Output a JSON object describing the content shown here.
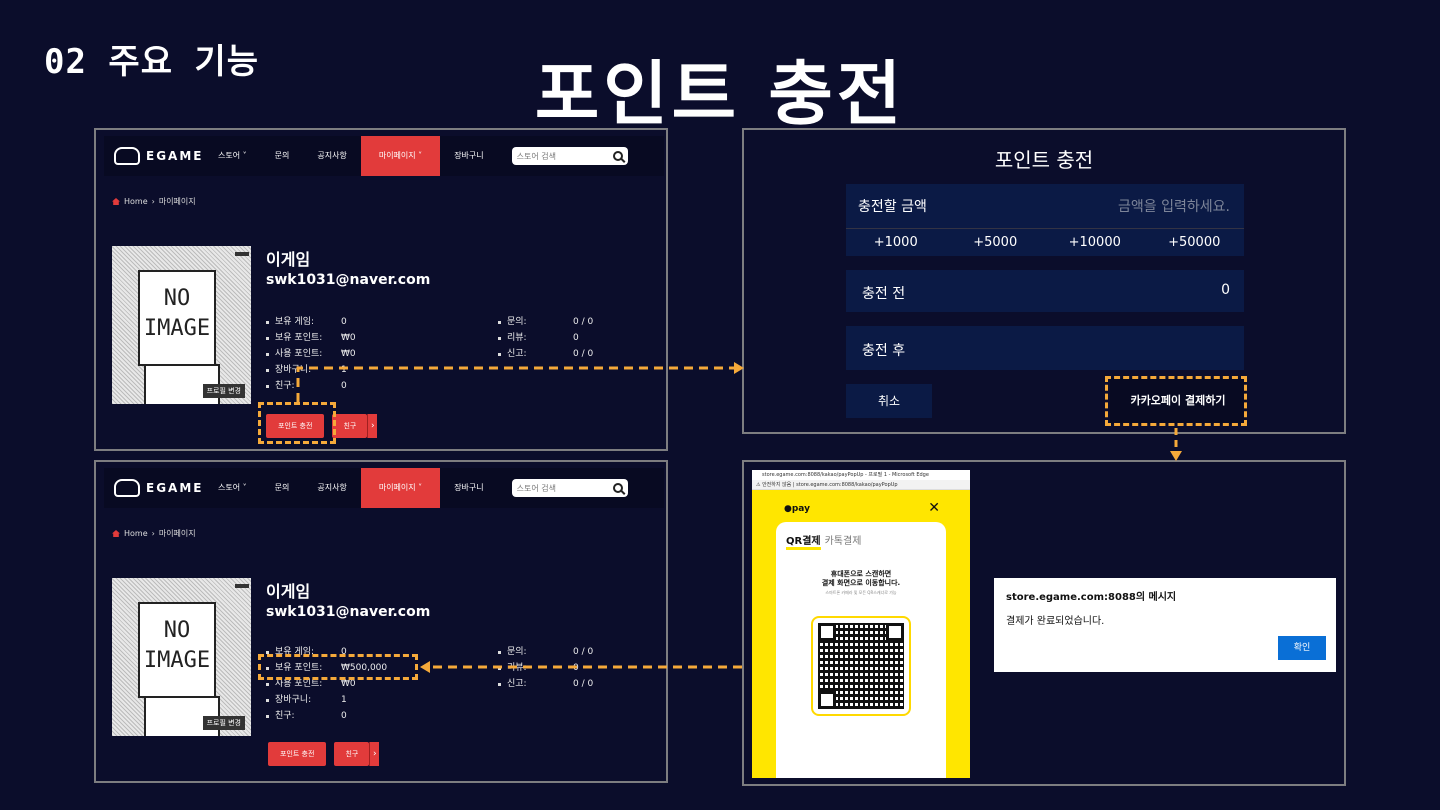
{
  "section_label": "02 주요 기능",
  "title": "포인트 충전",
  "site": {
    "logo": "EGAME",
    "nav": [
      "스토어",
      "문의",
      "공지사항",
      "마이페이지",
      "장바구니"
    ],
    "search_placeholder": "스토어 검색",
    "breadcrumb_home": "Home",
    "breadcrumb_current": "마이페이지",
    "profile_edit": "프로필 변경",
    "no_image": "NO IMAGE",
    "user_name": "이게임",
    "user_email": "swk1031@naver.com",
    "buttons": {
      "charge": "포인트 충전",
      "friends": "친구"
    }
  },
  "before": {
    "left_stats": [
      [
        "보유 게임:",
        "0"
      ],
      [
        "보유 포인트:",
        "₩0"
      ],
      [
        "사용 포인트:",
        "₩0"
      ],
      [
        "장바구니:",
        "1"
      ],
      [
        "친구:",
        "0"
      ]
    ],
    "right_stats": [
      [
        "문의:",
        "0 / 0"
      ],
      [
        "리뷰:",
        "0"
      ],
      [
        "신고:",
        "0 / 0"
      ]
    ]
  },
  "after": {
    "left_stats": [
      [
        "보유 게임:",
        "0"
      ],
      [
        "보유 포인트:",
        "₩500,000"
      ],
      [
        "사용 포인트:",
        "₩0"
      ],
      [
        "장바구니:",
        "1"
      ],
      [
        "친구:",
        "0"
      ]
    ],
    "right_stats": [
      [
        "문의:",
        "0 / 0"
      ],
      [
        "리뷰:",
        "0"
      ],
      [
        "신고:",
        "0 / 0"
      ]
    ]
  },
  "charge": {
    "title": "포인트 충전",
    "amount_label": "충전할 금액",
    "amount_placeholder": "금액을 입력하세요.",
    "quick": [
      "+1000",
      "+5000",
      "+10000",
      "+50000"
    ],
    "before_label": "충전 전",
    "before_value": "0",
    "after_label": "충전 후",
    "cancel": "취소",
    "kakaopay": "카카오페이 결제하기"
  },
  "popup": {
    "window_title": "store.egame.com:8088/kakao/payPopUp - 프로필 1 - Microsoft Edge",
    "address": "⚠ 안전하지 않음 | store.egame.com:8088/kakao/payPopUp",
    "pay_logo": "●pay",
    "tab_qr": "QR결제",
    "tab_talk": "카톡결제",
    "qr_text_1": "휴대폰으로 스캔하면",
    "qr_text_2": "결제 화면으로 이동합니다.",
    "qr_sub": "스마트폰 카메라 및 모든 QR스캐너로 가능"
  },
  "dialog": {
    "title": "store.egame.com:8088의 메시지",
    "message": "결제가 완료되었습니다.",
    "ok": "확인"
  },
  "colors": {
    "background": "#0b0d2b",
    "accent": "#e23b3b",
    "highlight": "#f5a93a",
    "kakao": "#ffe600"
  }
}
